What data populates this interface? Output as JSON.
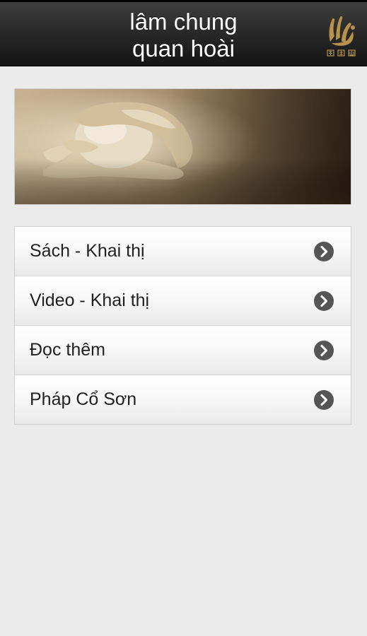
{
  "header": {
    "title_line1": "lâm chung",
    "title_line2": "quan hoài",
    "logo_icon": "dharma-drum-logo-icon",
    "logo_color": "#b8924a"
  },
  "banner": {
    "image_icon": "hands-holding-photo"
  },
  "menu": {
    "items": [
      {
        "label": "Sách - Khai thị",
        "icon": "chevron-right-circle-icon"
      },
      {
        "label": "Video - Khai thị",
        "icon": "chevron-right-circle-icon"
      },
      {
        "label": "Đọc thêm",
        "icon": "chevron-right-circle-icon"
      },
      {
        "label": "Pháp Cổ Sơn",
        "icon": "chevron-right-circle-icon"
      }
    ]
  },
  "colors": {
    "background": "#ebebeb",
    "header_dark": "#1a1a1a",
    "text": "#222222",
    "arrow": "#555555"
  }
}
